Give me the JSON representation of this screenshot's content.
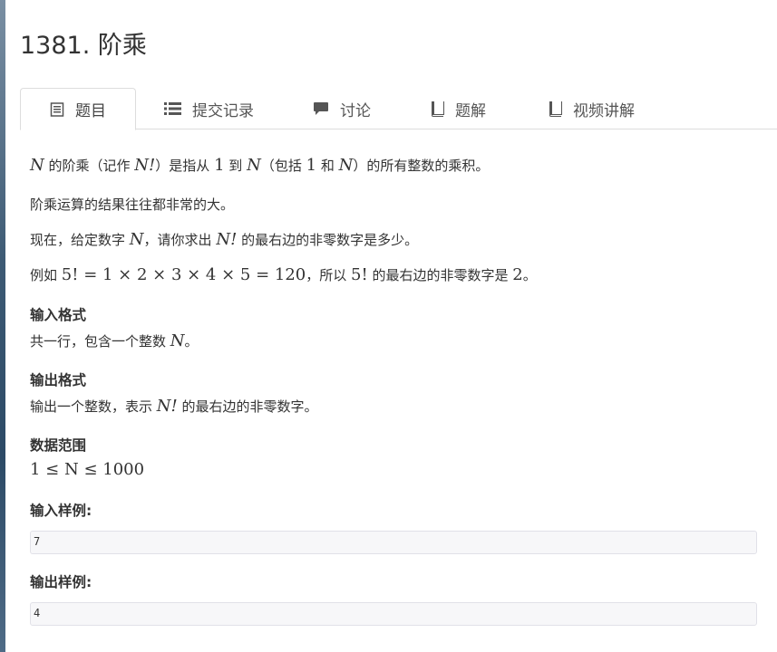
{
  "problem": {
    "title": "1381. 阶乘"
  },
  "tabs": [
    {
      "label": "题目",
      "icon": "document-icon"
    },
    {
      "label": "提交记录",
      "icon": "list-icon"
    },
    {
      "label": "讨论",
      "icon": "comment-icon"
    },
    {
      "label": "题解",
      "icon": "book-icon"
    },
    {
      "label": "视频讲解",
      "icon": "book-icon"
    }
  ],
  "description": {
    "line1": {
      "n1": "N",
      "t1": " 的阶乘（记作 ",
      "n2": "N!",
      "t2": "）是指从 ",
      "one": "1",
      "t3": " 到 ",
      "n3": "N",
      "t4": "（包括 ",
      "one2": "1",
      "t5": " 和 ",
      "n4": "N",
      "t6": "）的所有整数的乘积。"
    },
    "line2": "阶乘运算的结果往往都非常的大。",
    "line3": {
      "t1": "现在，给定数字 ",
      "n1": "N",
      "t2": "，请你求出 ",
      "n2": "N!",
      "t3": " 的最右边的非零数字是多少。"
    },
    "line4": {
      "t1": "例如 ",
      "expr": "5! = 1 × 2 × 3 × 4 × 5 = 120",
      "t2": "，所以 ",
      "m2": "5!",
      "t3": " 的最右边的非零数字是 ",
      "m3": "2",
      "t4": "。"
    }
  },
  "input_format": {
    "heading": "输入格式",
    "t1": "共一行，包含一个整数 ",
    "n1": "N",
    "t2": "。"
  },
  "output_format": {
    "heading": "输出格式",
    "t1": "输出一个整数，表示 ",
    "n1": "N!",
    "t2": " 的最右边的非零数字。"
  },
  "data_range": {
    "heading": "数据范围",
    "expr": "1 ≤ N ≤ 1000"
  },
  "sample_input": {
    "heading": "输入样例:",
    "value": "7"
  },
  "sample_output": {
    "heading": "输出样例:",
    "value": "4"
  }
}
